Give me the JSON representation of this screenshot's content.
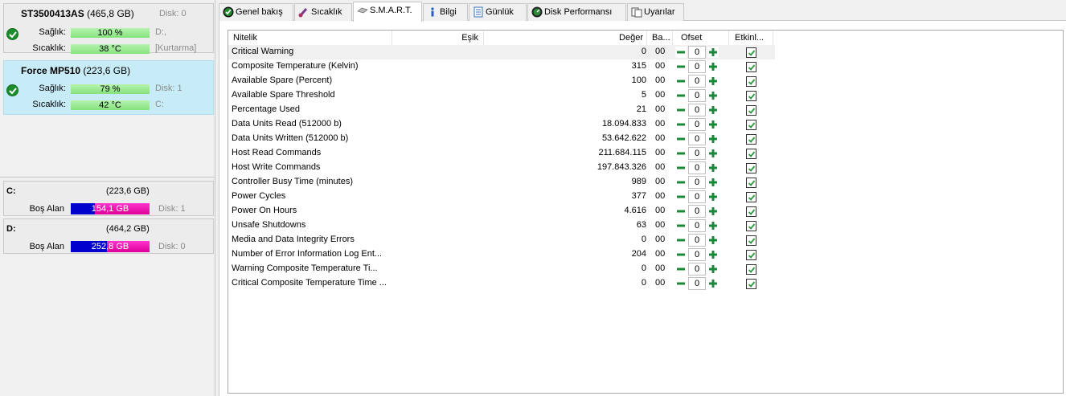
{
  "disks": [
    {
      "name": "ST3500413AS",
      "size": "(465,8 GB)",
      "disk": "Disk: 0",
      "health_label": "Sağlık:",
      "health": "100 %",
      "health_pct": 100,
      "health_right": "D:,",
      "temp_label": "Sıcaklık:",
      "temp": "38 °C",
      "temp_pct": 38,
      "temp_right": "[Kurtarma]"
    },
    {
      "name": "Force MP510",
      "size": "(223,6 GB)",
      "health_label": "Sağlık:",
      "health": "79 %",
      "health_pct": 79,
      "health_right": "Disk: 1",
      "temp_label": "Sıcaklık:",
      "temp": "42 °C",
      "temp_pct": 42,
      "temp_right": "C:"
    }
  ],
  "volumes": [
    {
      "name": "C:",
      "size": "(223,6 GB)",
      "free_label": "Boş Alan",
      "free": "154,1 GB",
      "used_fraction": 0.31,
      "disk": "Disk: 1"
    },
    {
      "name": "D:",
      "size": "(464,2 GB)",
      "free_label": "Boş Alan",
      "free": "252,8 GB",
      "used_fraction": 0.46,
      "disk": "Disk: 0"
    }
  ],
  "tabs": [
    {
      "label": "Genel bakış",
      "icon": "check-circle-icon"
    },
    {
      "label": "Sıcaklık",
      "icon": "thermometer-icon"
    },
    {
      "label": "S.M.A.R.T.",
      "icon": "drive-icon",
      "active": true
    },
    {
      "label": "Bilgi",
      "icon": "info-icon"
    },
    {
      "label": "Günlük",
      "icon": "log-icon"
    },
    {
      "label": "Disk Performansı",
      "icon": "performance-icon"
    },
    {
      "label": "Uyarılar",
      "icon": "alerts-icon"
    }
  ],
  "smart": {
    "headers": {
      "attr": "Nitelik",
      "threshold": "Eşik",
      "value": "Değer",
      "ba": "Ba...",
      "offset": "Ofset",
      "enabled": "Etkinl..."
    },
    "rows": [
      {
        "name": "Critical Warning",
        "value": "0",
        "ba": "00",
        "offset": "0"
      },
      {
        "name": "Composite Temperature (Kelvin)",
        "value": "315",
        "ba": "00",
        "offset": "0"
      },
      {
        "name": "Available Spare (Percent)",
        "value": "100",
        "ba": "00",
        "offset": "0"
      },
      {
        "name": "Available Spare Threshold",
        "value": "5",
        "ba": "00",
        "offset": "0"
      },
      {
        "name": "Percentage Used",
        "value": "21",
        "ba": "00",
        "offset": "0"
      },
      {
        "name": "Data Units Read (512000 b)",
        "value": "18.094.833",
        "ba": "00",
        "offset": "0"
      },
      {
        "name": "Data Units Written (512000 b)",
        "value": "53.642.622",
        "ba": "00",
        "offset": "0"
      },
      {
        "name": "Host Read Commands",
        "value": "211.684.115",
        "ba": "00",
        "offset": "0"
      },
      {
        "name": "Host Write Commands",
        "value": "197.843.326",
        "ba": "00",
        "offset": "0"
      },
      {
        "name": "Controller Busy Time (minutes)",
        "value": "989",
        "ba": "00",
        "offset": "0"
      },
      {
        "name": "Power Cycles",
        "value": "377",
        "ba": "00",
        "offset": "0"
      },
      {
        "name": "Power On Hours",
        "value": "4.616",
        "ba": "00",
        "offset": "0"
      },
      {
        "name": "Unsafe Shutdowns",
        "value": "63",
        "ba": "00",
        "offset": "0"
      },
      {
        "name": "Media and Data Integrity Errors",
        "value": "0",
        "ba": "00",
        "offset": "0"
      },
      {
        "name": "Number of Error Information Log Ent...",
        "value": "204",
        "ba": "00",
        "offset": "0"
      },
      {
        "name": "Warning Composite Temperature Ti...",
        "value": "0",
        "ba": "00",
        "offset": "0"
      },
      {
        "name": "Critical Composite Temperature Time ...",
        "value": "0",
        "ba": "00",
        "offset": "0"
      }
    ]
  }
}
